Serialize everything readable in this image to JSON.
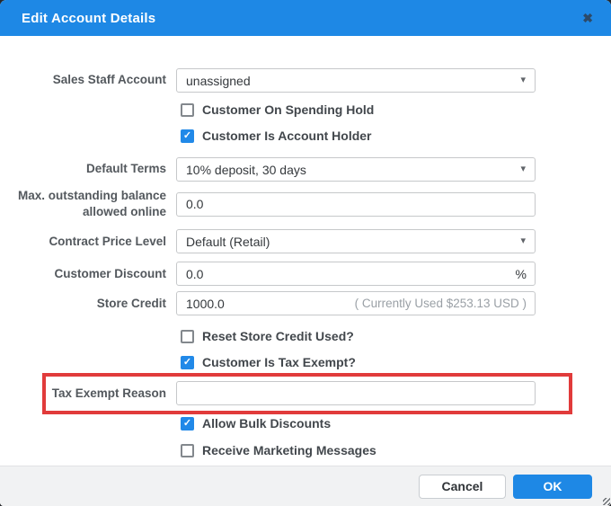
{
  "modal": {
    "title": "Edit Account Details"
  },
  "icons": {
    "close": "✖",
    "caret": "▾",
    "check": "✓"
  },
  "rows": {
    "sales_staff": {
      "label": "Sales Staff Account",
      "value": "unassigned"
    },
    "spending_hold": {
      "label": "Customer On Spending Hold",
      "checked": false
    },
    "account_holder": {
      "label": "Customer Is Account Holder",
      "checked": true
    },
    "default_terms": {
      "label": "Default Terms",
      "value": "10% deposit, 30 days"
    },
    "max_outstanding": {
      "label": "Max. outstanding balance allowed online",
      "value": "0.0"
    },
    "contract_price": {
      "label": "Contract Price Level",
      "value": "Default (Retail)"
    },
    "customer_discount": {
      "label": "Customer Discount",
      "value": "0.0",
      "suffix": "%"
    },
    "store_credit": {
      "label": "Store Credit",
      "value": "1000.0",
      "hint": "( Currently Used $253.13 USD )"
    },
    "reset_store_credit": {
      "label": "Reset Store Credit Used?",
      "checked": false
    },
    "tax_exempt": {
      "label": "Customer Is Tax Exempt?",
      "checked": true
    },
    "tax_exempt_reason": {
      "label": "Tax Exempt Reason",
      "value": ""
    },
    "bulk_discounts": {
      "label": "Allow Bulk Discounts",
      "checked": true
    },
    "marketing": {
      "label": "Receive Marketing Messages",
      "checked": false
    }
  },
  "footer": {
    "cancel_label": "Cancel",
    "ok_label": "OK"
  },
  "colors": {
    "accent_blue": "#1e88e5",
    "highlight_red": "#e13b3b"
  }
}
